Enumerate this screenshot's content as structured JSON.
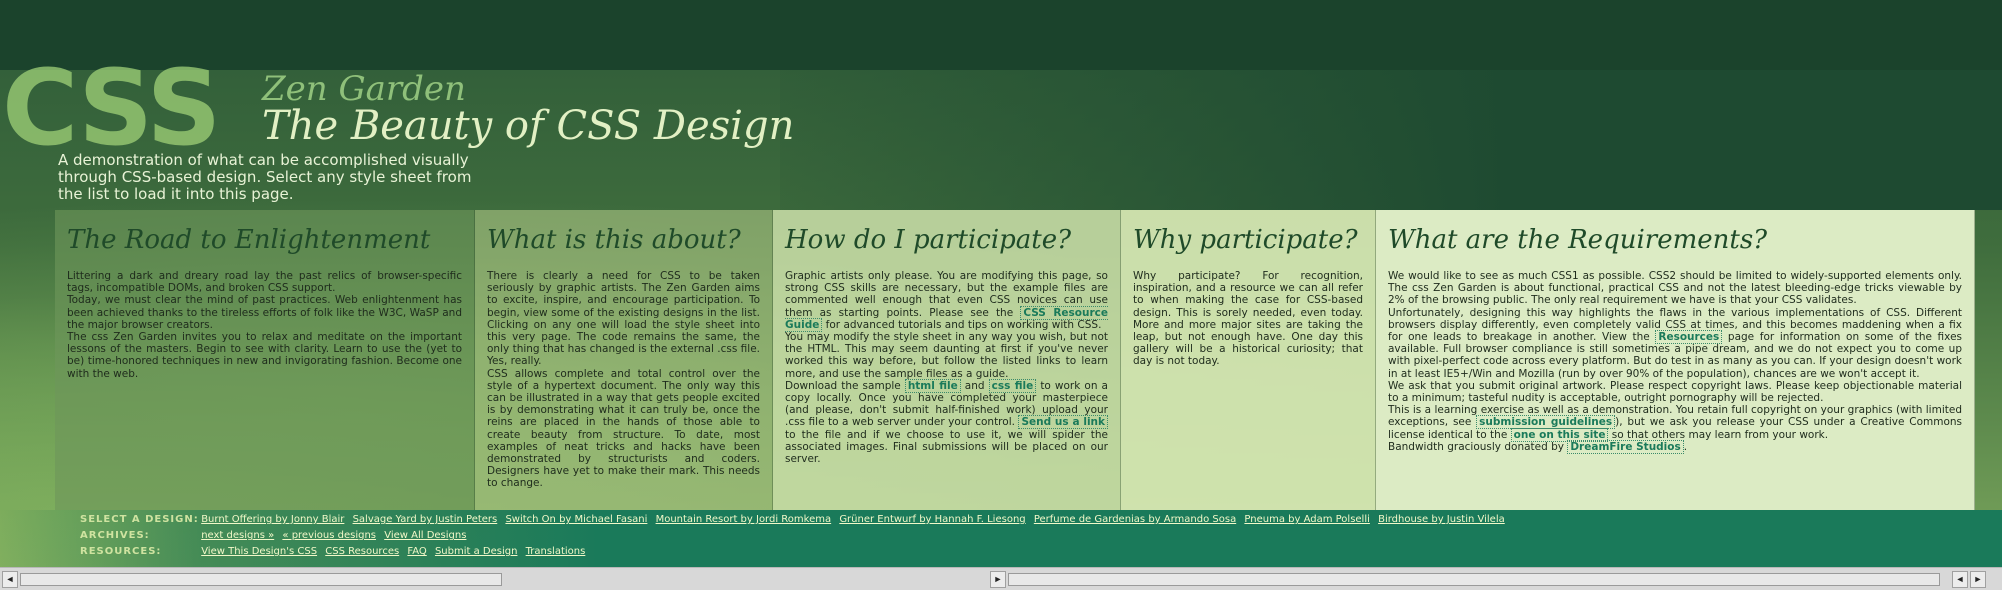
{
  "header": {
    "logo_css": "CSS",
    "logo_zen": "Zen Garden",
    "tagline": "The Beauty of CSS Design"
  },
  "intro": {
    "text": "A demonstration of what can be accomplished visually through CSS-based design. Select any style sheet from the list to load it into this page."
  },
  "sections": [
    {
      "title": "The Road to Enlightenment",
      "paragraphs": [
        "Littering a dark and dreary road lay the past relics of browser-specific tags, incompatible DOMs, and broken CSS support.",
        "Today, we must clear the mind of past practices. Web enlightenment has been achieved thanks to the tireless efforts of folk like the W3C, WaSP and the major browser creators.",
        "The css Zen Garden invites you to relax and meditate on the important lessons of the masters. Begin to see with clarity. Learn to use the (yet to be) time-honored techniques in new and invigorating fashion. Become one with the web."
      ]
    },
    {
      "title": "What is this about?",
      "paragraphs": [
        "There is clearly a need for CSS to be taken seriously by graphic artists. The Zen Garden aims to excite, inspire, and encourage participation. To begin, view some of the existing designs in the list. Clicking on any one will load the style sheet into this very page. The code remains the same, the only thing that has changed is the external .css file. Yes, really.",
        "CSS allows complete and total control over the style of a hypertext document. The only way this can be illustrated in a way that gets people excited is by demonstrating what it can truly be, once the reins are placed in the hands of those able to create beauty from structure. To date, most examples of neat tricks and hacks have been demonstrated by structurists and coders. Designers have yet to make their mark. This needs to change."
      ]
    },
    {
      "title": "How do I participate?",
      "p1_a": "Graphic artists only please. You are modifying this page, so strong CSS skills are necessary, but the example files are commented well enough that even CSS novices can use them as starting points. Please see the ",
      "p1_link": "CSS Resource Guide",
      "p1_b": " for advanced tutorials and tips on working with CSS.",
      "p2": "You may modify the style sheet in any way you wish, but not the HTML. This may seem daunting at first if you've never worked this way before, but follow the listed links to learn more, and use the sample files as a guide.",
      "p3_a": "Download the sample ",
      "p3_link1": "html file",
      "p3_b": " and ",
      "p3_link2": "css file",
      "p3_c": " to work on a copy locally. Once you have completed your masterpiece (and please, don't submit half-finished work) upload your .css file to a web server under your control. ",
      "p3_link3": "Send us a link",
      "p3_d": " to the file and if we choose to use it, we will spider the associated images. Final submissions will be placed on our server."
    },
    {
      "title": "Why participate?",
      "paragraphs": [
        "Why participate? For recognition, inspiration, and a resource we can all refer to when making the case for CSS-based design. This is sorely needed, even today. More and more major sites are taking the leap, but not enough have. One day this gallery will be a historical curiosity; that day is not today."
      ]
    },
    {
      "title": "What are the Requirements?",
      "p1_a": "We would like to see as much CSS1 as possible. CSS2 should be limited to widely-supported elements only. The css Zen Garden is about functional, practical CSS and not the latest bleeding-edge tricks viewable by 2% of the browsing public. The only real requirement we have is that your CSS validates.",
      "p2_a": "Unfortunately, designing this way highlights the flaws in the various implementations of CSS. Different browsers display differently, even completely valid CSS at times, and this becomes maddening when a fix for one leads to breakage in another. View the ",
      "p2_link": "Resources",
      "p2_b": " page for information on some of the fixes available. Full browser compliance is still sometimes a pipe dream, and we do not expect you to come up with pixel-perfect code across every platform. But do test in as many as you can. If your design doesn't work in at least IE5+/Win and Mozilla (run by over 90% of the population), chances are we won't accept it.",
      "p3": "We ask that you submit original artwork. Please respect copyright laws. Please keep objectionable material to a minimum; tasteful nudity is acceptable, outright pornography will be rejected.",
      "p4_a": "This is a learning exercise as well as a demonstration. You retain full copyright on your graphics (with limited exceptions, see ",
      "p4_link1": "submission guidelines",
      "p4_b": "), but we ask you release your CSS under a Creative Commons license identical to the ",
      "p4_link2": "one on this site",
      "p4_c": " so that others may learn from your work.",
      "p5_a": "Bandwidth graciously donated by ",
      "p5_link": "DreamFire Studios",
      "p5_b": "."
    }
  ],
  "nav": {
    "select_label": "SELECT A DESIGN:",
    "designs": [
      "Burnt Offering by Jonny Blair",
      "Salvage Yard by Justin Peters",
      "Switch On by Michael Fasani",
      "Mountain Resort by Jordi Romkema",
      "Grüner Entwurf by Hannah F. Liesong",
      "Perfume de Gardenias by Armando Sosa",
      "Pneuma by Adam Polselli",
      "Birdhouse by Justin Vilela"
    ],
    "archives_label": "ARCHIVES:",
    "archives": [
      "next designs »",
      "« previous designs",
      "View All Designs"
    ],
    "resources_label": "RESOURCES:",
    "resources": [
      "View This Design's CSS",
      "CSS Resources",
      "FAQ",
      "Submit a Design",
      "Translations"
    ]
  },
  "scrollbar": {
    "left_arrow": "◄",
    "right_arrow": "►"
  },
  "colors": {
    "top_bar": "#1b432c",
    "nav_bar": "#1a7a5a",
    "heading": "#1f4a29",
    "link": "#1a7a5a"
  }
}
